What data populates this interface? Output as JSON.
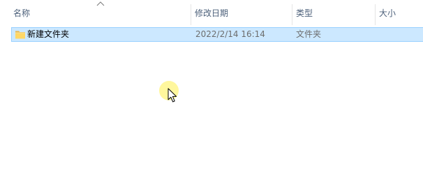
{
  "columns": {
    "name": "名称",
    "date_modified": "修改日期",
    "type": "类型",
    "size": "大小"
  },
  "sort": {
    "column": "name",
    "direction": "ascending",
    "icon": "chevron-up-icon"
  },
  "files": [
    {
      "name": "新建文件夹",
      "date_modified": "2022/2/14 16:14",
      "type": "文件夹",
      "size": "",
      "icon": "folder-icon",
      "selected": true
    }
  ],
  "colors": {
    "selection_background": "#cce8ff",
    "selection_border": "#99d1ff",
    "header_text": "#4c607a",
    "secondary_text": "#6d6d6d",
    "folder_yellow": "#ffd766",
    "cursor_highlight": "#fff68c"
  },
  "cursor": {
    "icon": "mouse-pointer-icon",
    "highlighted": true
  }
}
